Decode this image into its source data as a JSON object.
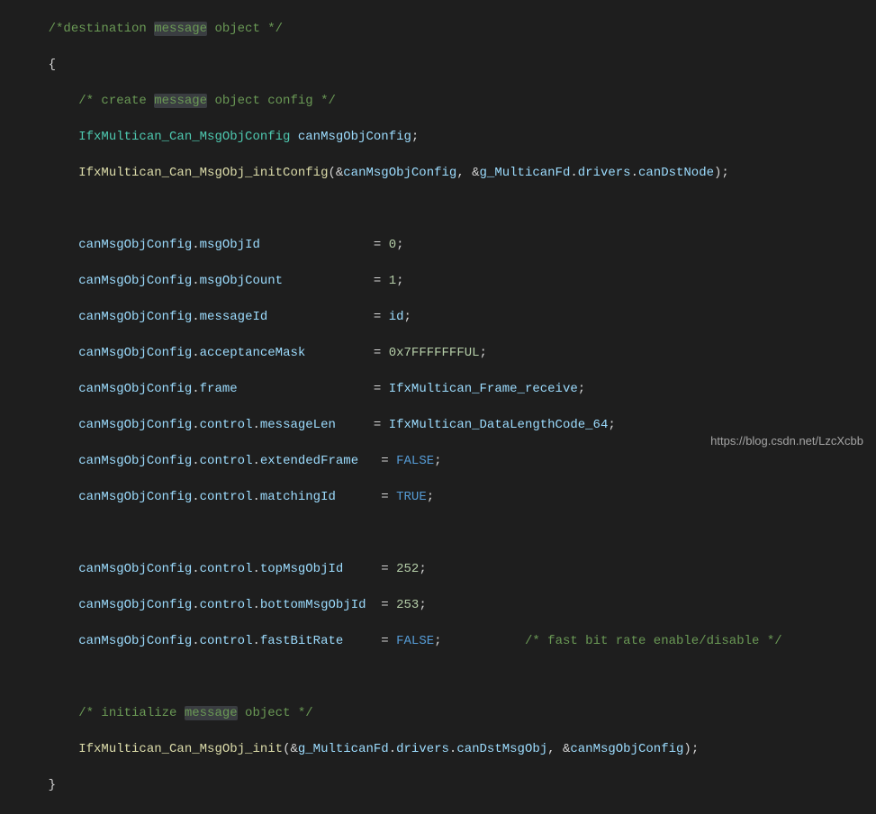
{
  "code": {
    "comment_destination": "/*destination ",
    "comment_destination_hl": "message",
    "comment_destination_end": " object */",
    "brace_open": "{",
    "indent1": "        ",
    "indent2": "    ",
    "comment_create": "/* create ",
    "comment_create_hl": "message",
    "comment_create_end": " object config */",
    "type_msgobjconfig": "IfxMultican_Can_MsgObjConfig",
    "var_canmsgobjconfig": "canMsgObjConfig",
    "func_initconfig": "IfxMultican_Can_MsgObj_initConfig",
    "amp": "&",
    "var_g_multicanfd": "g_MulticanFd",
    "member_drivers": "drivers",
    "member_candstnode": "canDstNode",
    "member_msgObjId": "msgObjId",
    "member_msgObjCount": "msgObjCount",
    "member_messageId": "messageId",
    "member_acceptanceMask": "acceptanceMask",
    "member_frame": "frame",
    "member_control": "control",
    "member_messageLen": "messageLen",
    "member_extendedFrame": "extendedFrame",
    "member_matchingId": "matchingId",
    "member_topMsgObjId": "topMsgObjId",
    "member_bottomMsgObjId": "bottomMsgObjId",
    "member_fastBitRate": "fastBitRate",
    "val_0": "0",
    "val_1": "1",
    "val_id": "id",
    "val_mask": "0x7FFFFFFFUL",
    "val_frame_receive": "IfxMultican_Frame_receive",
    "val_datalen64": "IfxMultican_DataLengthCode_64",
    "val_false": "FALSE",
    "val_true": "TRUE",
    "val_252": "252",
    "val_253": "253",
    "comment_fastbit": "/* fast bit rate enable/disable */",
    "comment_initialize": "/* initialize ",
    "comment_initialize_hl": "message",
    "comment_initialize_end": " object */",
    "func_msgobj_init": "IfxMultican_Can_MsgObj_init",
    "member_candstmsgobj": "canDstMsgObj",
    "brace_close": "    }",
    "dot": ".",
    "comma": ", ",
    "semicolon": ";",
    "eq": " = ",
    "paren_open": "(",
    "paren_close": ")",
    "space_pad1": "              ",
    "space_pad2": "           ",
    "space_pad3": "             ",
    "space_pad4": "        ",
    "space_pad5": "                 ",
    "space_pad6": "    ",
    "space_pad7": "  ",
    "space_pad8": "    ",
    "space_pad9": "     ",
    "space_pad10": " ",
    "space_pad11": "   ",
    "space_pad_fastbit": "           "
  },
  "watermark": "https://blog.csdn.net/LzcXcbb"
}
